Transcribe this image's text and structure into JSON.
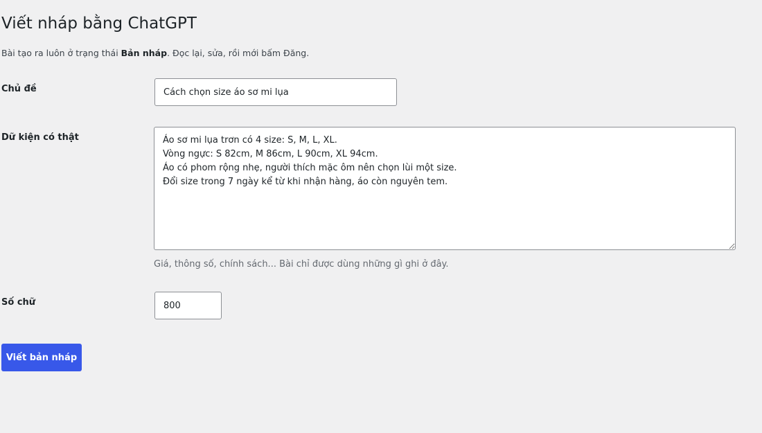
{
  "page": {
    "title": "Viết nháp bằng ChatGPT",
    "intro_prefix": "Bài tạo ra luôn ở trạng thái ",
    "intro_bold": "Bản nháp",
    "intro_suffix": ". Đọc lại, sửa, rồi mới bấm Đăng."
  },
  "form": {
    "topic": {
      "label": "Chủ đề",
      "value": "Cách chọn size áo sơ mi lụa"
    },
    "facts": {
      "label": "Dữ kiện có thật",
      "value": "Áo sơ mi lụa trơn có 4 size: S, M, L, XL.\nVòng ngực: S 82cm, M 86cm, L 90cm, XL 94cm.\nÁo có phom rộng nhẹ, người thích mặc ôm nên chọn lùi một size.\nĐổi size trong 7 ngày kể từ khi nhận hàng, áo còn nguyên tem.",
      "help": "Giá, thông số, chính sách... Bài chỉ được dùng những gì ghi ở đây."
    },
    "word_count": {
      "label": "Số chữ",
      "value": "800"
    },
    "submit_label": "Viết bản nháp"
  },
  "colors": {
    "background": "#f0f0f1",
    "accent": "#3858e9",
    "border": "#8c8f94"
  }
}
